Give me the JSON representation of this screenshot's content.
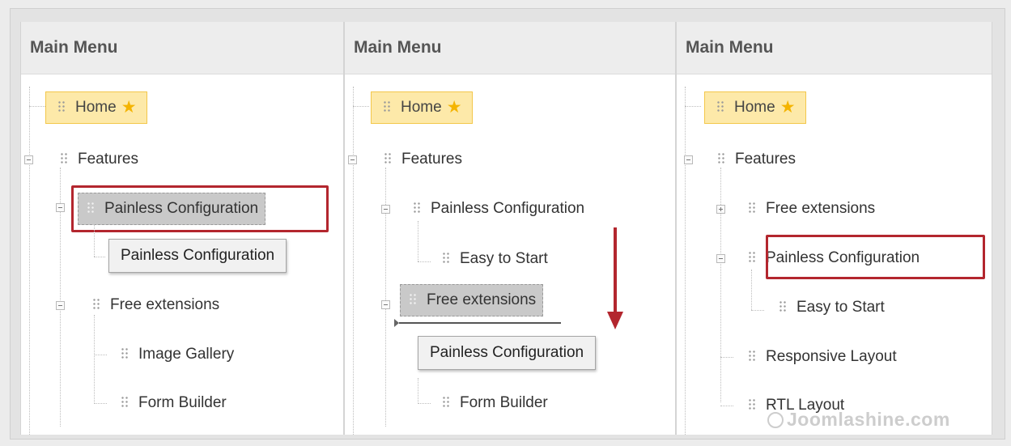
{
  "panels": [
    {
      "header": "Main Menu",
      "items": [
        "Home",
        "Features",
        "Painless Configuration",
        "Free extensions",
        "Image Gallery",
        "Form Builder"
      ],
      "drag_ghost": "Painless Configuration"
    },
    {
      "header": "Main Menu",
      "items": [
        "Home",
        "Features",
        "Painless Configuration",
        "Easy to Start",
        "Free extensions",
        "Form Builder"
      ],
      "drag_ghost": "Painless Configuration"
    },
    {
      "header": "Main Menu",
      "items": [
        "Home",
        "Features",
        "Free extensions",
        "Painless Configuration",
        "Easy to Start",
        "Responsive Layout",
        "RTL Layout"
      ]
    }
  ],
  "watermark": "Joomlashine.com",
  "colors": {
    "highlight": "#b3262e",
    "home_bg": "#fde9a9",
    "arrow": "#b3262e"
  },
  "icons": {
    "home_star": "star-icon",
    "drag": "grip-icon",
    "toggle": "tree-toggle-icon"
  }
}
